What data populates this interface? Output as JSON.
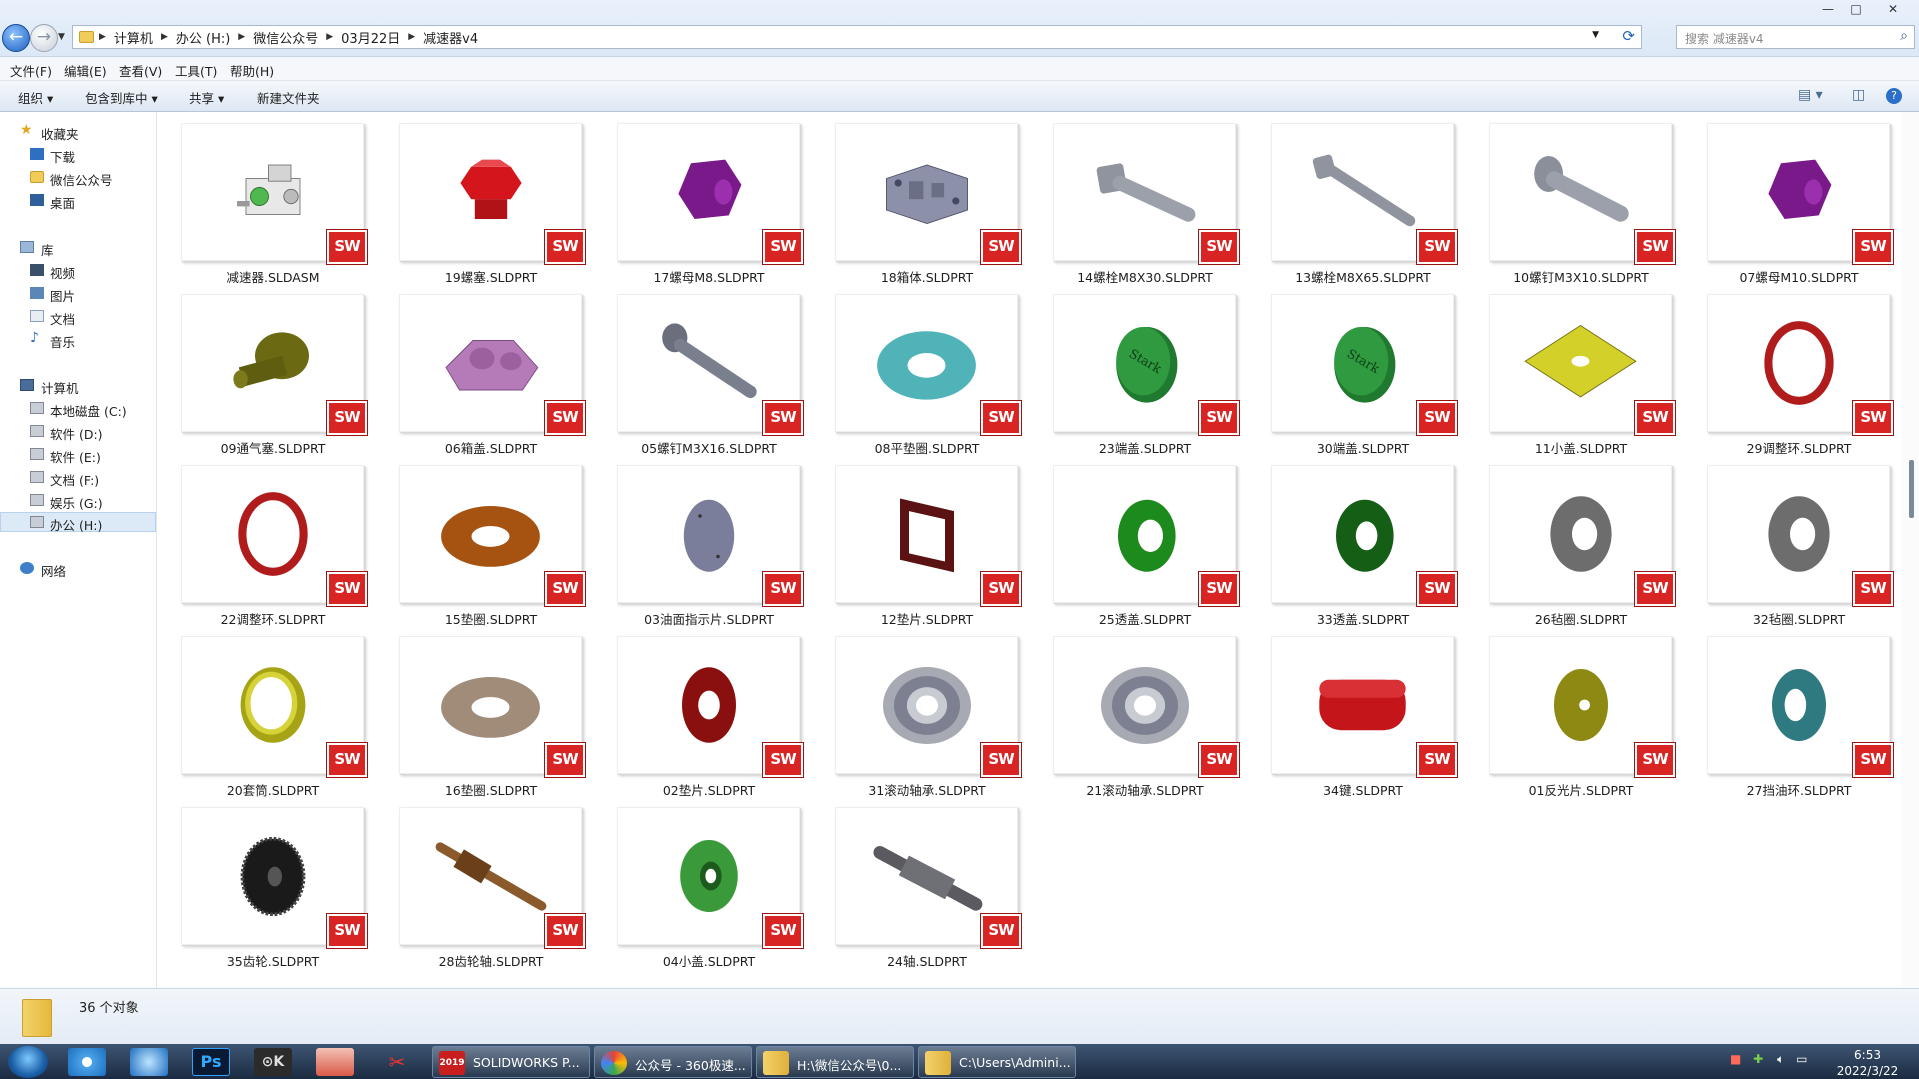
{
  "window": {
    "breadcrumbs": [
      "计算机",
      "办公 (H:)",
      "微信公众号",
      "03月22日",
      "减速器v4"
    ],
    "search_placeholder": "搜索 减速器v4",
    "controls": {
      "minimize": "—",
      "maximize": "□",
      "close": "✕"
    }
  },
  "menubar": [
    "文件(F)",
    "编辑(E)",
    "查看(V)",
    "工具(T)",
    "帮助(H)"
  ],
  "toolbar": {
    "organize": "组织 ▾",
    "include_library": "包含到库中 ▾",
    "share": "共享 ▾",
    "new_folder": "新建文件夹"
  },
  "nav": {
    "favorites": {
      "label": "收藏夹",
      "items": [
        "下载",
        "微信公众号",
        "桌面"
      ]
    },
    "libraries": {
      "label": "库",
      "items": [
        "视频",
        "图片",
        "文档",
        "音乐"
      ]
    },
    "computer": {
      "label": "计算机",
      "items": [
        "本地磁盘 (C:)",
        "软件 (D:)",
        "软件 (E:)",
        "文档 (F:)",
        "娱乐 (G:)",
        "办公 (H:)"
      ]
    },
    "network": {
      "label": "网络"
    }
  },
  "files": [
    {
      "name": "减速器.SLDASM",
      "icon": "assembly"
    },
    {
      "name": "19螺塞.SLDPRT",
      "icon": "plug-red"
    },
    {
      "name": "17螺母M8.SLDPRT",
      "icon": "nut-purple"
    },
    {
      "name": "18箱体.SLDPRT",
      "icon": "housing-grey"
    },
    {
      "name": "14螺栓M8X30.SLDPRT",
      "icon": "bolt"
    },
    {
      "name": "13螺栓M8X65.SLDPRT",
      "icon": "bolt-long"
    },
    {
      "name": "10螺钉M3X10.SLDPRT",
      "icon": "screw"
    },
    {
      "name": "07螺母M10.SLDPRT",
      "icon": "nut-purple"
    },
    {
      "name": "09通气塞.SLDPRT",
      "icon": "vent-olive"
    },
    {
      "name": "06箱盖.SLDPRT",
      "icon": "cover-pink"
    },
    {
      "name": "05螺钉M3X16.SLDPRT",
      "icon": "screw-threaded"
    },
    {
      "name": "08平垫圈.SLDPRT",
      "icon": "washer-teal"
    },
    {
      "name": "23端盖.SLDPRT",
      "icon": "endcap-green"
    },
    {
      "name": "30端盖.SLDPRT",
      "icon": "endcap-green"
    },
    {
      "name": "11小盖.SLDPRT",
      "icon": "plate-yellow"
    },
    {
      "name": "29调整环.SLDPRT",
      "icon": "ring-red"
    },
    {
      "name": "22调整环.SLDPRT",
      "icon": "ring-red"
    },
    {
      "name": "15垫圈.SLDPRT",
      "icon": "washer-brown"
    },
    {
      "name": "03油面指示片.SLDPRT",
      "icon": "disc-slate"
    },
    {
      "name": "12垫片.SLDPRT",
      "icon": "gasket-square"
    },
    {
      "name": "25透盖.SLDPRT",
      "icon": "cap-green"
    },
    {
      "name": "33透盖.SLDPRT",
      "icon": "cap-darkgreen"
    },
    {
      "name": "26毡圈.SLDPRT",
      "icon": "felt-grey"
    },
    {
      "name": "32毡圈.SLDPRT",
      "icon": "felt-grey"
    },
    {
      "name": "20套筒.SLDPRT",
      "icon": "sleeve-yellow"
    },
    {
      "name": "16垫圈.SLDPRT",
      "icon": "washer-tan"
    },
    {
      "name": "02垫片.SLDPRT",
      "icon": "gasket-red"
    },
    {
      "name": "31滚动轴承.SLDPRT",
      "icon": "bearing"
    },
    {
      "name": "21滚动轴承.SLDPRT",
      "icon": "bearing"
    },
    {
      "name": "34键.SLDPRT",
      "icon": "key-red"
    },
    {
      "name": "01反光片.SLDPRT",
      "icon": "disc-olive"
    },
    {
      "name": "27挡油环.SLDPRT",
      "icon": "ring-teal"
    },
    {
      "name": "35齿轮.SLDPRT",
      "icon": "gear-black"
    },
    {
      "name": "28齿轮轴.SLDPRT",
      "icon": "gearshaft"
    },
    {
      "name": "04小盖.SLDPRT",
      "icon": "smallcap-green"
    },
    {
      "name": "24轴.SLDPRT",
      "icon": "shaft-grey"
    }
  ],
  "badge_label": "SW",
  "status": {
    "count": "36 个对象"
  },
  "taskbar": {
    "tasks": [
      {
        "label": "SOLIDWORKS P...",
        "sub": "2019"
      },
      {
        "label": "公众号 - 360极速..."
      },
      {
        "label": "H:\\微信公众号\\0..."
      },
      {
        "label": "C:\\Users\\Admini..."
      }
    ],
    "clock_time": "6:53",
    "clock_date": "2022/3/22"
  }
}
